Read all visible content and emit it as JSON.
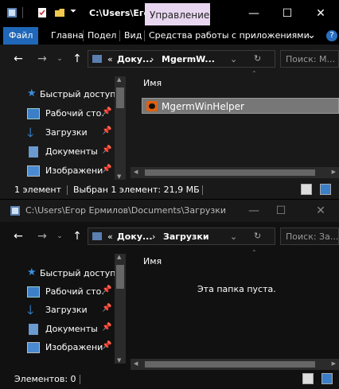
{
  "window1": {
    "title": "C:\\Users\\Егор",
    "manage_tab": "Управление",
    "minimize": "—",
    "maximize": "☐",
    "close": "✕",
    "ribbon": {
      "file": "Файл",
      "home": "Главна",
      "share": "Подел",
      "view": "Вид",
      "app_tools": "Средства работы с приложениями",
      "expand": "⌄",
      "help": "?"
    },
    "address": {
      "prefix": "«",
      "part1": "Доку...",
      "sep": "›",
      "part2": "MgermW...",
      "chevron": "⌄",
      "refresh": "↻"
    },
    "search_placeholder": "Поиск: М...",
    "nav": [
      {
        "label": "Быстрый доступ",
        "icon": "star-icon"
      },
      {
        "label": "Рабочий сто.",
        "icon": "desktop-icon"
      },
      {
        "label": "Загрузки",
        "icon": "download-icon"
      },
      {
        "label": "Документы",
        "icon": "documents-icon"
      },
      {
        "label": "Изображени",
        "icon": "pictures-icon"
      }
    ],
    "column_name": "Имя",
    "file": "MgermWinHelper",
    "status_items": "1 элемент",
    "status_selected": "Выбран 1 элемент: 21,9 МБ"
  },
  "window2": {
    "title": "C:\\Users\\Егор Ермилов\\Documents\\Загрузки",
    "minimize": "—",
    "maximize": "☐",
    "close": "✕",
    "address": {
      "prefix": "«",
      "part1": "Доку...",
      "sep": "›",
      "part2": "Загрузки",
      "chevron": "⌄",
      "refresh": "↻"
    },
    "search_placeholder": "Поиск: За...",
    "nav": [
      {
        "label": "Быстрый доступ",
        "icon": "star-icon"
      },
      {
        "label": "Рабочий сто.",
        "icon": "desktop-icon"
      },
      {
        "label": "Загрузки",
        "icon": "download-icon"
      },
      {
        "label": "Документы",
        "icon": "documents-icon"
      },
      {
        "label": "Изображени",
        "icon": "pictures-icon"
      }
    ],
    "column_name": "Имя",
    "empty_text": "Эта папка пуста.",
    "status_items": "Элементов: 0"
  },
  "colors": {
    "accent": "#1f67b8",
    "manage": "#e8d6f0",
    "bg": "#191919"
  }
}
